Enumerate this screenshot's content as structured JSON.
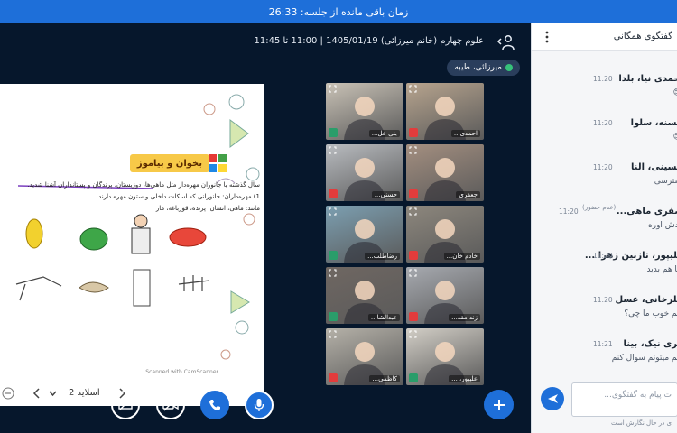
{
  "timer_bar": {
    "text": "زمان باقی مانده از جلسه: 26:33"
  },
  "session": {
    "title": "علوم چهارم (خانم میرزائی) 1405/01/19 | 11:00 تا 11:45"
  },
  "presenter": {
    "name": "میرزائی، طیبه"
  },
  "slide": {
    "heading": "بخوان و بیاموز",
    "line1": "سال گذشته با جانوران مهره‌دار مثل ماهی‌ها، دوزیستان، پرندگان و پستانداران آشنا شدید.",
    "line2": "1) مهره‌داران: جانورانی که اسکلت داخلی و ستون مهره دارند.",
    "line3": "مانند: ماهی، انسان، پرنده، قورباغه، مار",
    "watermark": "Scanned with CamScanner"
  },
  "slide_nav": {
    "slide_label": "اسلاید 2"
  },
  "video_tiles": [
    {
      "name": "بنی عل...",
      "mic": "on",
      "bg": "#c9c2b6"
    },
    {
      "name": "احمدی...",
      "mic": "off",
      "bg": "#b7a48e"
    },
    {
      "name": "حسنی...",
      "mic": "off",
      "bg": "#b9bcc0"
    },
    {
      "name": "جعفری",
      "mic": "off",
      "bg": "#a48f80"
    },
    {
      "name": "رضاطلب...",
      "mic": "on",
      "bg": "#7c9fb1"
    },
    {
      "name": "خادم خان...",
      "mic": "off",
      "bg": "#8d877d"
    },
    {
      "name": "عبدالشا...",
      "mic": "on",
      "bg": "#6f6762"
    },
    {
      "name": "زند مقد...",
      "mic": "off",
      "bg": "#a7aab0"
    },
    {
      "name": "کاظمی...",
      "mic": "off",
      "bg": "#b5b1a8"
    },
    {
      "name": "علیپور، ...",
      "mic": "on",
      "bg": "#d2cec6"
    }
  ],
  "chat": {
    "title": "گفتگوی همگانی",
    "messages": [
      {
        "sender": "احمدی نیا، بلدا",
        "time": "11:20",
        "body": "😊"
      },
      {
        "sender": "حسنه، سلوا",
        "time": "11:20",
        "body": "😊"
      },
      {
        "sender": "حسینی، النا",
        "time": "11:20",
        "body": "سترسی"
      },
      {
        "sender": "صفری ماهی...",
        "time": "11:20",
        "badge": "(عدم حضور)",
        "body": "بدش اوره"
      },
      {
        "sender": "علیپور، نازنین زهرا ...",
        "time": "11:20",
        "body": "ما هم بدید"
      },
      {
        "sender": "انلرخانی، عسل",
        "time": "11:20",
        "body": "انم خوب ما چی؟"
      },
      {
        "sender": "فری نیک، بینا",
        "time": "11:21",
        "body": "انم میتونم سوال کنم"
      }
    ],
    "input_placeholder": "ت پیام به گفتگوی...",
    "typing_note": "ی در حال نگارش است"
  },
  "colors": {
    "topbar": "#1e6fd9",
    "main_bg": "#06172c",
    "accent": "#1e6fd9"
  }
}
